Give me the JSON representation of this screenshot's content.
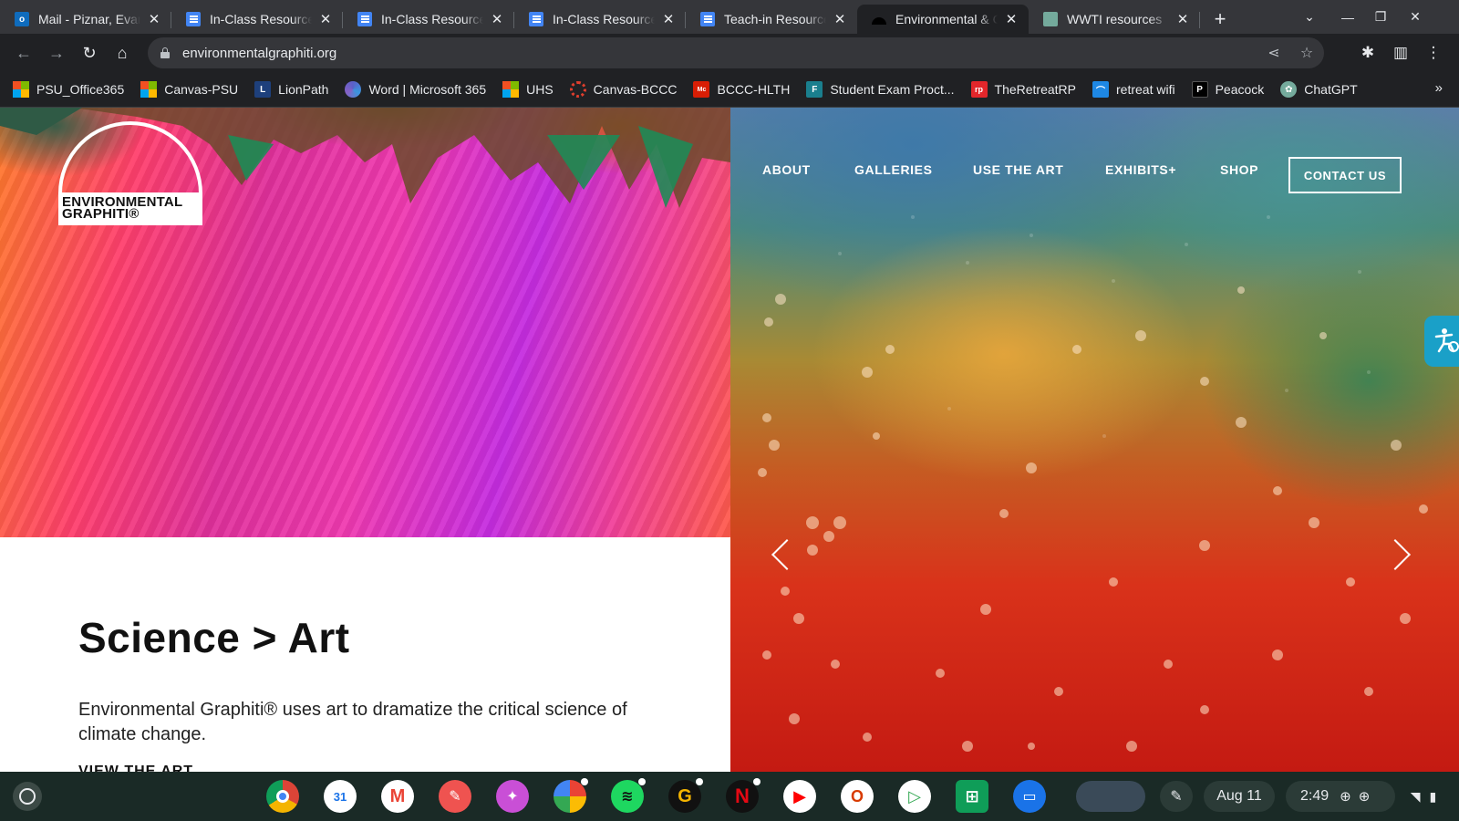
{
  "browser": {
    "tabs": [
      {
        "title": "Mail - Piznar, Evan N",
        "favicon": "outlook-icon"
      },
      {
        "title": "In-Class Resources",
        "favicon": "docs-icon"
      },
      {
        "title": "In-Class Resources",
        "favicon": "docs-icon"
      },
      {
        "title": "In-Class Resources",
        "favicon": "docs-icon"
      },
      {
        "title": "Teach-in Resources",
        "favicon": "docs-icon"
      },
      {
        "title": "Environmental & Clim",
        "favicon": "environmental-graphiti-icon",
        "active": true
      },
      {
        "title": "WWTI resources",
        "favicon": "chatgpt-icon"
      }
    ],
    "url": "environmentalgraphiti.org",
    "bookmarks": [
      {
        "label": "PSU_Office365",
        "icon": "microsoft-icon"
      },
      {
        "label": "Canvas-PSU",
        "icon": "microsoft-icon"
      },
      {
        "label": "LionPath",
        "icon": "lionpath-icon"
      },
      {
        "label": "Word | Microsoft 365",
        "icon": "microsoft365-icon"
      },
      {
        "label": "UHS",
        "icon": "microsoft-icon"
      },
      {
        "label": "Canvas-BCCC",
        "icon": "canvas-icon"
      },
      {
        "label": "BCCC-HLTH",
        "icon": "mcgraw-hill-icon"
      },
      {
        "label": "Student Exam Proct...",
        "icon": "forms-icon"
      },
      {
        "label": "TheRetreatRP",
        "icon": "retreat-icon"
      },
      {
        "label": "retreat wifi",
        "icon": "wifi-bookmark-icon"
      },
      {
        "label": "Peacock",
        "icon": "peacock-icon"
      },
      {
        "label": "ChatGPT",
        "icon": "chatgpt-icon"
      }
    ]
  },
  "site": {
    "logo_line1": "ENVIRONMENTAL",
    "logo_line2": "GRAPHITI®",
    "nav": [
      "ABOUT",
      "GALLERIES",
      "USE THE ART",
      "EXHIBITS+",
      "SHOP"
    ],
    "contact": "CONTACT US",
    "headline": "Science > Art",
    "subtext": "Environmental Graphiti® uses art to dramatize the critical science of climate change.",
    "cta": "VIEW THE ART"
  },
  "shelf": {
    "apps": [
      "chrome",
      "google-calendar",
      "gmail",
      "art-app",
      "canvas-app",
      "google-photos",
      "spotify",
      "grammarly",
      "netflix",
      "youtube",
      "office",
      "play-store",
      "sheets",
      "files"
    ],
    "calendar_day": "31",
    "date": "Aug 11",
    "time": "2:49"
  },
  "colors": {
    "chrome_frame": "#35363a",
    "chrome_toolbar": "#202124",
    "shelf": "#1a2a26",
    "accessibility": "#1aa0c8"
  }
}
